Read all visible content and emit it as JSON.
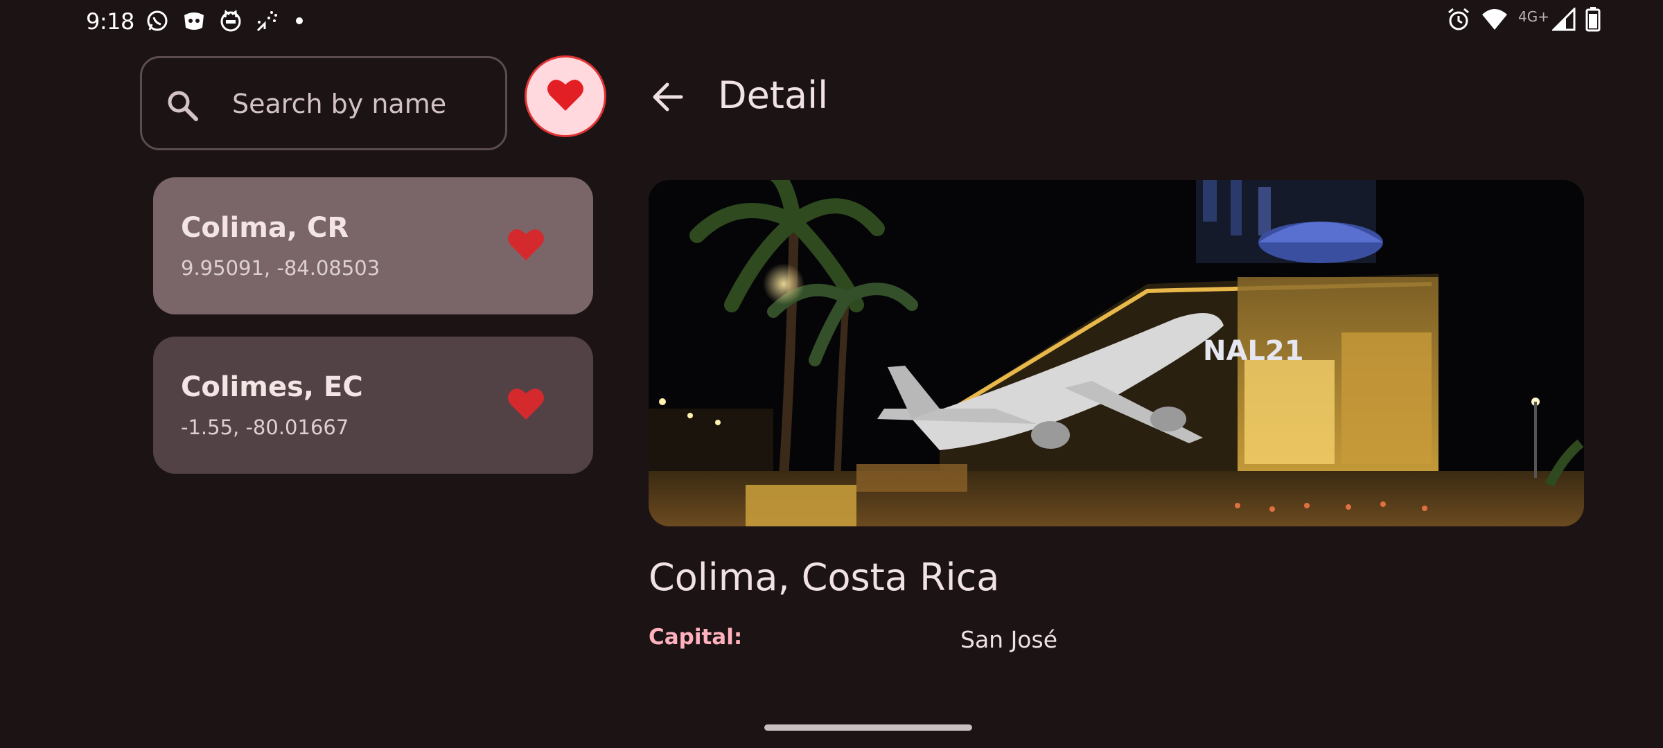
{
  "status_bar": {
    "time": "9:18",
    "network": "4G+",
    "left_icons": [
      "whatsapp-icon",
      "discord-icon",
      "cat-app-icon",
      "sprinkler-icon",
      "dot-icon"
    ],
    "right_icons": [
      "alarm-icon",
      "wifi-icon",
      "signal-icon",
      "battery-icon"
    ]
  },
  "search": {
    "placeholder": "Search by name",
    "value": ""
  },
  "favorites_filter": {
    "icon": "heart-icon",
    "active": true,
    "accent": "#e03434"
  },
  "list": {
    "items": [
      {
        "name": "Colima, CR",
        "coords": "9.95091, -84.08503",
        "favorite": true,
        "selected": true
      },
      {
        "name": "Colimes, EC",
        "coords": "-1.55, -80.01667",
        "favorite": true,
        "selected": false
      }
    ]
  },
  "detail": {
    "header_title": "Detail",
    "image_sign_text": "NAL21",
    "heading": "Colima, Costa Rica",
    "capital_label": "Capital:",
    "capital_value": "San José"
  },
  "colors": {
    "background": "#1c1315",
    "selected_card": "#7a6669",
    "card": "#524245",
    "heart": "#e03434",
    "label_accent": "#ffb1bd"
  }
}
